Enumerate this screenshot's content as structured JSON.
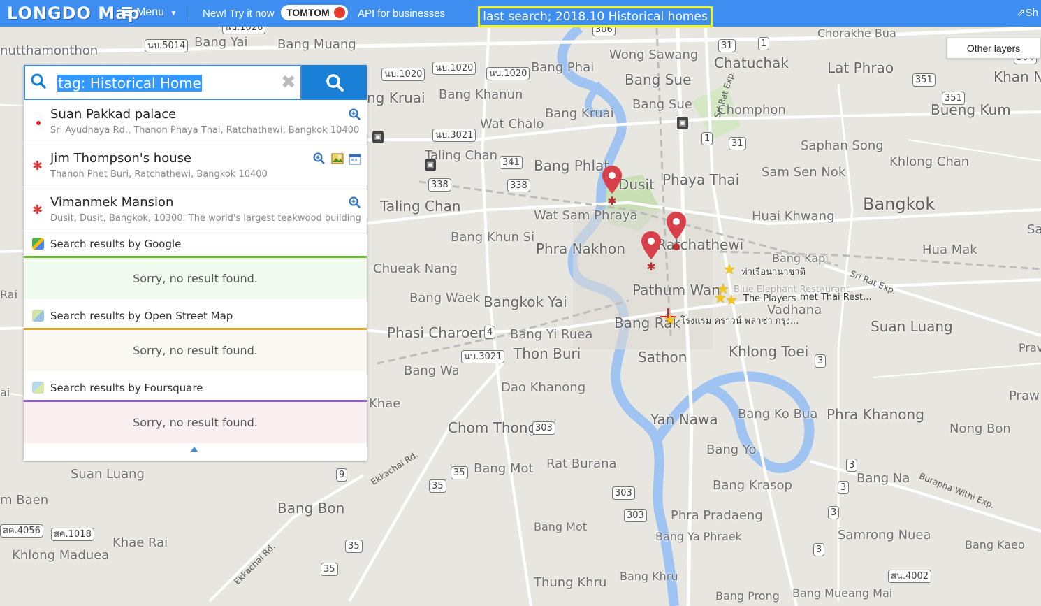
{
  "topbar": {
    "logo": "LONGDO Map",
    "menu_label": "Menu",
    "tomtom_text": "New! Try it now",
    "tomtom_brand": "TOMTOM",
    "api_label": "API for businesses",
    "last_search": "last search;  2018.10  Historical homes",
    "share_label": "Sh"
  },
  "layers": {
    "label": "Other layers"
  },
  "search": {
    "query": "tag: Historical Home",
    "clear_glyph": "✖"
  },
  "results": [
    {
      "title": "Suan Pakkad palace",
      "address": "Sri Ayudhaya Rd., Thanon Phaya Thai, Ratchathewi, Bangkok 10400"
    },
    {
      "title": "Jim Thompson's house",
      "address": "Thanon Phet Buri, Ratchathewi, Bangkok 10400"
    },
    {
      "title": "Vimanmek Mansion",
      "address": "Dusit, Dusit, Bangkok, 10300. The world's largest teakwood building"
    }
  ],
  "sections": [
    {
      "label": "Search results by Google",
      "message": "Sorry, no result found.",
      "color": "#6bc02a",
      "bg": "#f1fbef"
    },
    {
      "label": "Search results by Open Street Map",
      "message": "Sorry, no result found.",
      "color": "#e0a92c",
      "bg": "#faf8f2"
    },
    {
      "label": "Search results by Foursquare",
      "message": "Sorry, no result found.",
      "color": "#8e5cc9",
      "bg": "#f9eef0"
    }
  ],
  "map": {
    "places": [
      "nutthamonthon",
      "Bang Yai",
      "Bang Muang",
      "ng Kruai",
      "Bang Khanun",
      "Bang Phai",
      "Wong Sawang",
      "Bang Sue",
      "Chatuchak",
      "Lat Phrao",
      "Khan Na",
      "Chorakhe Bua",
      "Bang Kruai",
      "Bang Sue",
      "Chomphon",
      "Bueng Kum",
      "Wat Chalo",
      "Taling Chan",
      "Bang Phlat",
      "Dusit",
      "Phaya Thai",
      "Saphan Song",
      "Sam Sen Nok",
      "Khlong Chan",
      "Bangkok",
      "Taling Chan",
      "Wat Sam Phraya",
      "Huai Khwang",
      "Ratchathewi",
      "Bang Khun Si",
      "Phra Nakhon",
      "Bang Kapi",
      "Hua Mak",
      "Chueak Nang",
      "Bang Waek",
      "Bangkok Yai",
      "Pathum Wan",
      "Vadhana",
      "Bang Rak",
      "Suan Luang",
      "Phasi Charoen",
      "Bang Yi Ruea",
      "Thon Buri",
      "Khlong Toei",
      "Sathon",
      "Bang Wa",
      "Dao Khanong",
      "Khae",
      "Yan Nawa",
      "Bang Ko Bua",
      "Phra Khanong",
      "Praw",
      "Chom Thong",
      "Nong Bon",
      "Bang Yo",
      "Rat Burana",
      "Suan Luang",
      "Bang Mot",
      "Bang Krasop",
      "Bang Na",
      "m Baen",
      "Bang Bon",
      "Phra Pradaeng",
      "Bang Mot",
      "Khae Rai",
      "Samrong Nuea",
      "Bang Kaeo",
      "Khlong Maduea",
      "Bang Ya Phraek",
      "Thung Khru",
      "Bang Khru",
      "Bang Prong",
      "Bang Mueang Mai",
      "Hua Mak",
      "Sa",
      "Prav",
      "Rai",
      "ai"
    ],
    "shields": [
      "นบ.1026",
      "นบ.5014",
      "นบ.1020",
      "นบ.1020",
      "นบ.1020",
      "306",
      "31",
      "1",
      "351",
      "351",
      "31",
      "1",
      "341",
      "338",
      "338",
      "นบ.3021",
      "4",
      "นบ.3021",
      "303",
      "3",
      "3",
      "3",
      "3",
      "9",
      "35",
      "35",
      "303",
      "303",
      "3",
      "สค.1018",
      "35",
      "35",
      "สน.4002",
      "สค.4056",
      "304"
    ],
    "roads": [
      "Sri Rat Exp.",
      "Sri Rat Exp.",
      "Burapha Withi Exp.",
      "Ekkachai Rd.",
      "Ekkachai Rd."
    ],
    "pois": [
      "ท่าเรือนานาชาติ",
      "The Players",
      "met Thai Rest...",
      "Blue Elephant Restaurant",
      "โรงแรม คราวน์ พลาซ่า กรุง..."
    ],
    "accent_water": "#9fc4f2",
    "accent_park": "#c8dfb4",
    "accent_pin": "#d8404a"
  }
}
